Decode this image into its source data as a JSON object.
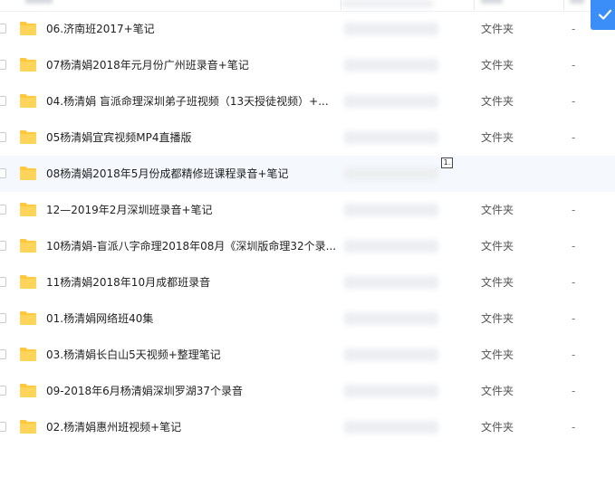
{
  "list": {
    "rows": [
      {
        "name": "06.济南班2017+笔记",
        "type": "文件夹",
        "extra": "-"
      },
      {
        "name": "07杨清娟2018年元月份广州班录音+笔记",
        "type": "文件夹",
        "extra": "-"
      },
      {
        "name": "04.杨清娟 盲派命理深圳弟子班视频（13天授徒视频）+...",
        "type": "文件夹",
        "extra": "-"
      },
      {
        "name": "05杨清娟宜宾视频MP4直播版",
        "type": "文件夹",
        "extra": "-"
      },
      {
        "name": "08杨清娟2018年5月份成都精修班课程录音+笔记",
        "type": "",
        "extra": ""
      },
      {
        "name": "12—2019年2月深圳班录音+笔记",
        "type": "文件夹",
        "extra": "-"
      },
      {
        "name": "10杨清娟-盲派八字命理2018年08月《深圳版命理32个录...",
        "type": "文件夹",
        "extra": "-"
      },
      {
        "name": "11杨清娟2018年10月成都班录音",
        "type": "文件夹",
        "extra": "-"
      },
      {
        "name": "01.杨清娟网络班40集",
        "type": "文件夹",
        "extra": "-"
      },
      {
        "name": "03.杨清娟长白山5天视频+整理笔记",
        "type": "文件夹",
        "extra": "-"
      },
      {
        "name": "09-2018年6月杨清娟深圳罗湖37个录音",
        "type": "文件夹",
        "extra": "-"
      },
      {
        "name": "02.杨清娟惠州班视频+笔记",
        "type": "文件夹",
        "extra": "-"
      }
    ],
    "hover_row": 4,
    "hover_marker": "1."
  },
  "icons": {
    "row_icon": "folder-icon",
    "confirm": "check-icon"
  },
  "colors": {
    "folder": "#ffc83d",
    "accent": "#3b8ef8",
    "hover": "#f5f8fd"
  }
}
